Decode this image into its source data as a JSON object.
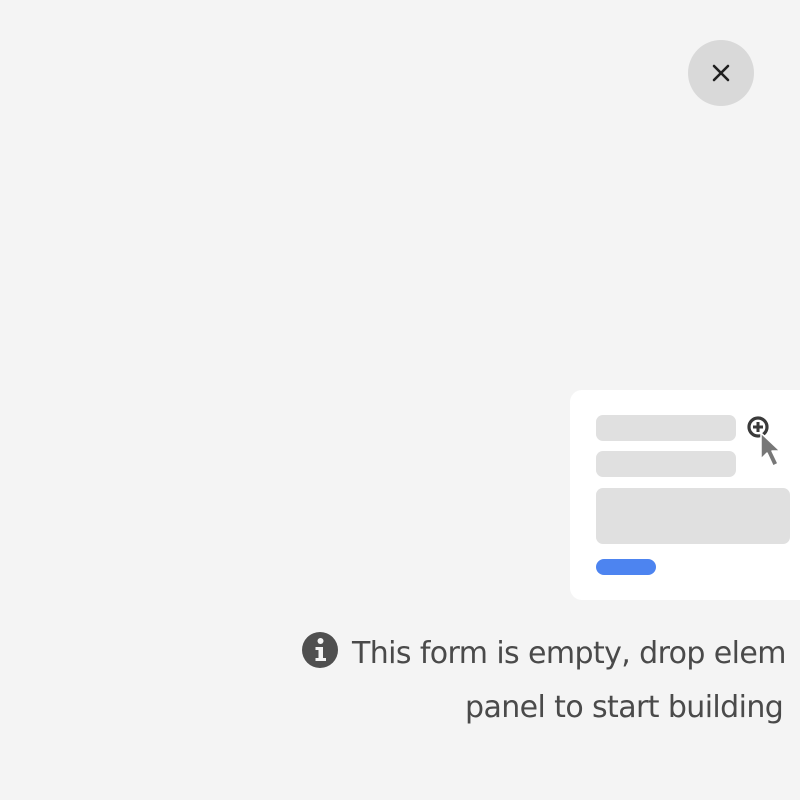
{
  "close": {
    "icon": "close-icon",
    "background": "#d9d9d9"
  },
  "illustration": {
    "cursor_icon": "cursor-add-icon",
    "accent": "#4d84f0"
  },
  "empty_state": {
    "icon": "info-icon",
    "line1": "This form is empty, drop elem",
    "line2": "panel to start building"
  }
}
